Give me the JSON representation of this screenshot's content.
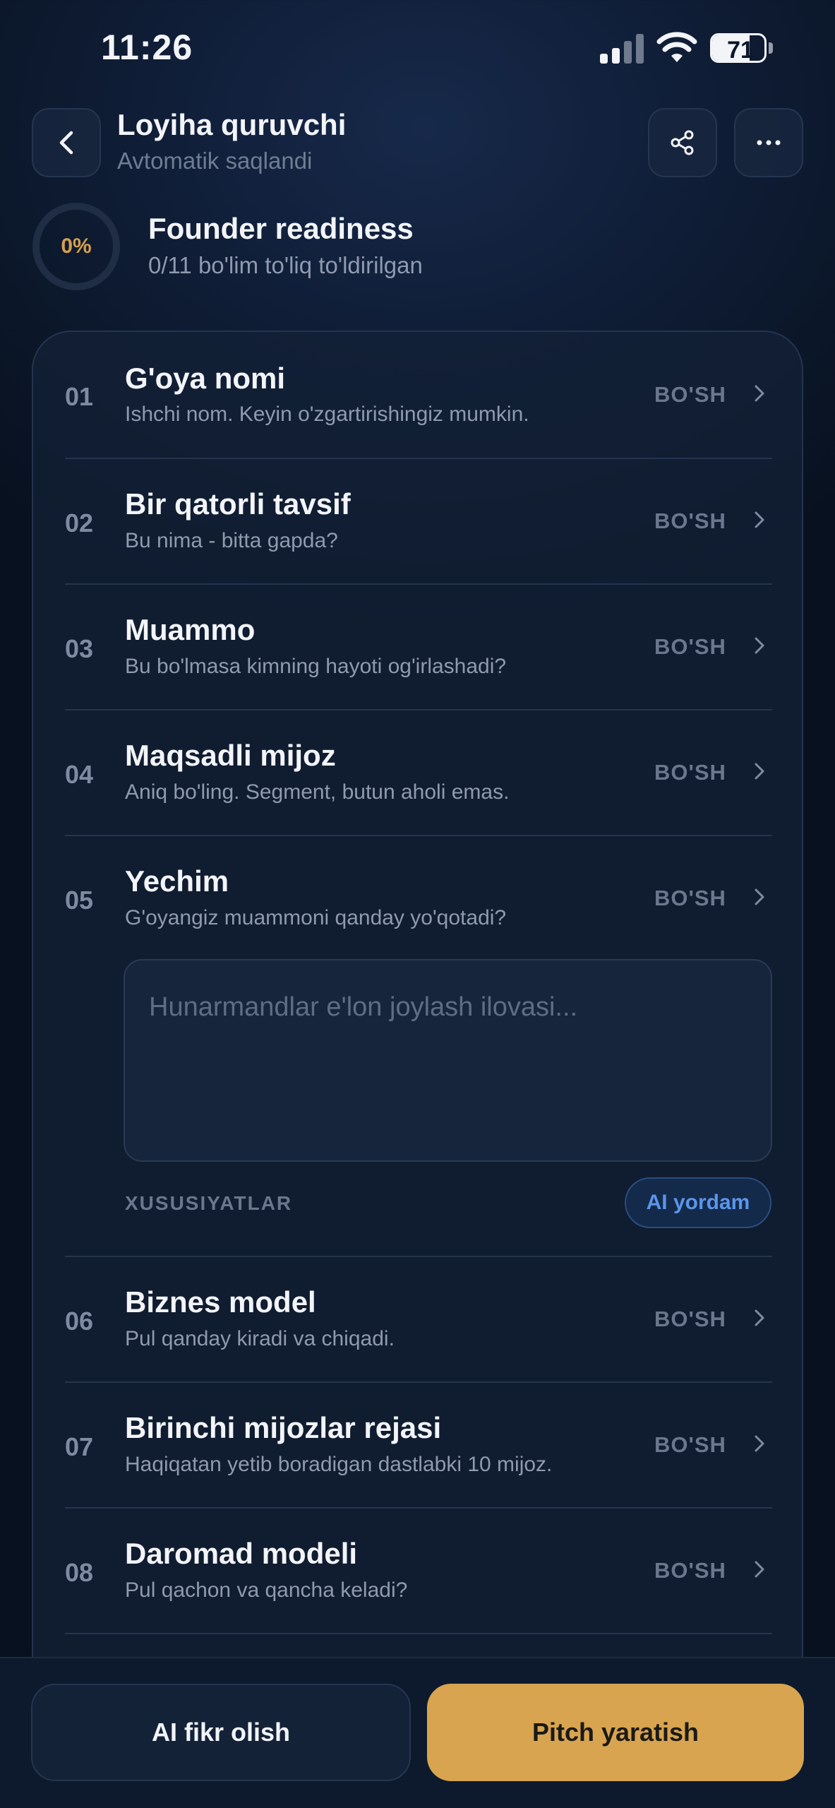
{
  "status_bar": {
    "time": "11:26",
    "battery": "71",
    "battery_level": 0.71
  },
  "header": {
    "title": "Loyiha quruvchi",
    "subtitle": "Avtomatik saqlandi",
    "icons": {
      "back": "chevron-left-icon",
      "share": "share-icon",
      "more": "more-horizontal-icon"
    }
  },
  "readiness": {
    "percent_label": "0%",
    "progress": 0,
    "title": "Founder readiness",
    "subtitle": "0/11 bo'lim to'liq to'ldirilgan",
    "accent_color": "#d6a04d"
  },
  "sections": [
    {
      "num": "01",
      "title": "G'oya nomi",
      "desc": "Ishchi nom. Keyin o'zgartirishingiz mumkin.",
      "status": "BO'SH"
    },
    {
      "num": "02",
      "title": "Bir qatorli tavsif",
      "desc": "Bu nima - bitta gapda?",
      "status": "BO'SH"
    },
    {
      "num": "03",
      "title": "Muammo",
      "desc": "Bu bo'lmasa kimning hayoti og'irlashadi?",
      "status": "BO'SH"
    },
    {
      "num": "04",
      "title": "Maqsadli mijoz",
      "desc": "Aniq bo'ling. Segment, butun aholi emas.",
      "status": "BO'SH"
    },
    {
      "num": "05",
      "title": "Yechim",
      "desc": "G'oyangiz muammoni qanday yo'qotadi?",
      "status": "BO'SH",
      "expanded": true,
      "input_placeholder": "Hunarmandlar e'lon joylash ilovasi...",
      "input_value": "",
      "features_label": "XUSUSIYATLAR",
      "ai_help_label": "AI yordam"
    },
    {
      "num": "06",
      "title": "Biznes model",
      "desc": "Pul qanday kiradi va chiqadi.",
      "status": "BO'SH"
    },
    {
      "num": "07",
      "title": "Birinchi mijozlar rejasi",
      "desc": "Haqiqatan yetib boradigan dastlabki 10 mijoz.",
      "status": "BO'SH"
    },
    {
      "num": "08",
      "title": "Daromad modeli",
      "desc": "Pul qachon va qancha keladi?",
      "status": "BO'SH"
    }
  ],
  "bottom_bar": {
    "feedback_label": "AI fikr olish",
    "pitch_label": "Pitch yaratish",
    "pitch_color": "#d8a450"
  }
}
